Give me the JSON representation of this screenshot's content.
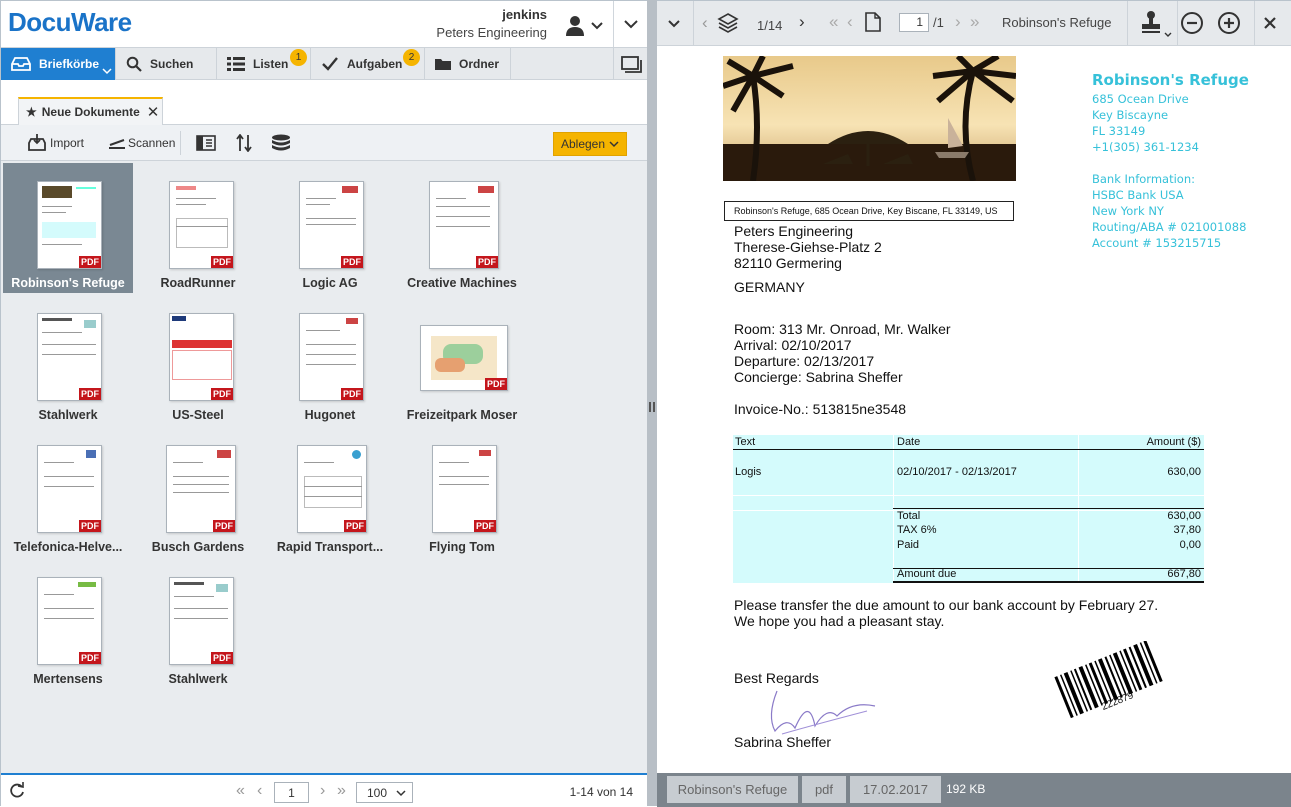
{
  "app": {
    "logo": "DocuWare",
    "user_name": "jenkins",
    "user_org": "Peters Engineering"
  },
  "nav": {
    "tabs": [
      {
        "label": "Briefkörbe",
        "badge": ""
      },
      {
        "label": "Suchen",
        "badge": ""
      },
      {
        "label": "Listen",
        "badge": "1"
      },
      {
        "label": "Aufgaben",
        "badge": "2"
      },
      {
        "label": "Ordner",
        "badge": ""
      }
    ]
  },
  "doc_tab": {
    "label": "Neue Dokumente"
  },
  "toolbar": {
    "import_label": "Import",
    "scan_label": "Scannen",
    "store_label": "Ablegen"
  },
  "documents": [
    {
      "name": "Robinson's Refuge",
      "badge": "PDF"
    },
    {
      "name": "RoadRunner",
      "badge": "PDF"
    },
    {
      "name": "Logic AG",
      "badge": "PDF"
    },
    {
      "name": "Creative Machines",
      "badge": "PDF"
    },
    {
      "name": "Stahlwerk",
      "badge": "PDF"
    },
    {
      "name": "US-Steel",
      "badge": "PDF"
    },
    {
      "name": "Hugonet",
      "badge": "PDF"
    },
    {
      "name": "Freizeitpark Moser",
      "badge": "PDF"
    },
    {
      "name": "Telefonica-Helve...",
      "badge": "PDF"
    },
    {
      "name": "Busch Gardens",
      "badge": "PDF"
    },
    {
      "name": "Rapid Transport...",
      "badge": "PDF"
    },
    {
      "name": "Flying Tom",
      "badge": "PDF"
    },
    {
      "name": "Mertensens",
      "badge": "PDF"
    },
    {
      "name": "Stahlwerk",
      "badge": "PDF"
    }
  ],
  "pager": {
    "page": "1",
    "page_size": "100",
    "summary": "1-14 von 14"
  },
  "viewer": {
    "page_indicator": "1/14",
    "page_input": "1",
    "page_total": "/1",
    "doc_title": "Robinson's Refuge",
    "status": {
      "name": "Robinson's Refuge",
      "type": "pdf",
      "date": "17.02.2017",
      "size": "192 KB"
    }
  },
  "invoice": {
    "company": "Robinson's Refuge",
    "address": [
      "685 Ocean Drive",
      "Key Biscayne",
      "FL 33149",
      "+1(305) 361-1234"
    ],
    "bank_title": "Bank Information:",
    "bank": [
      "HSBC Bank USA",
      "New York NY",
      "Routing/ABA # 021001088",
      "Account # 153215715"
    ],
    "sender_line": "Robinson's Refuge, 685 Ocean Drive, Key Biscane, FL 33149, US",
    "recipient": [
      "Peters Engineering",
      "Therese-Giehse-Platz 2",
      "82110 Germering"
    ],
    "country": "GERMANY",
    "stay": [
      "Room: 313 Mr. Onroad, Mr. Walker",
      "Arrival: 02/10/2017",
      "Departure: 02/13/2017",
      "Concierge: Sabrina Sheffer"
    ],
    "invoice_no": "Invoice-No.: 513815ne3548",
    "table": {
      "headers": [
        "Text",
        "Date",
        "Amount ($)"
      ],
      "row": {
        "text": "Logis",
        "date": "02/10/2017 - 02/13/2017",
        "amount": "630,00"
      },
      "totals": [
        {
          "label": "Total",
          "value": "630,00"
        },
        {
          "label": "TAX 6%",
          "value": "37,80"
        },
        {
          "label": "Paid",
          "value": "0,00"
        }
      ],
      "amount_due": {
        "label": "Amount due",
        "value": "667,80"
      }
    },
    "closing": [
      "Please transfer the due amount to our bank account by February 27.",
      "We hope you had a pleasant stay."
    ],
    "regards": "Best Regards",
    "signer": "Sabrina Sheffer",
    "barcode_number": "222879"
  },
  "colors": {
    "accent": "#1f7fd1",
    "badge": "#f5b400",
    "invoice_cyan": "#36c1d9",
    "table_fill": "#d4fbfc"
  }
}
